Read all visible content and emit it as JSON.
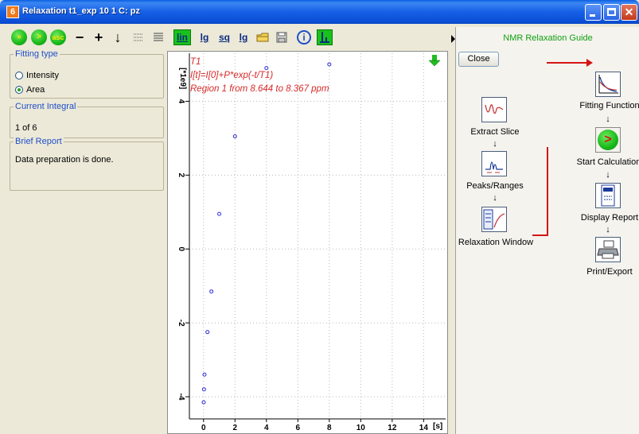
{
  "window": {
    "badge": "6",
    "title": "Relaxation t1_exp  10  1  C: pz"
  },
  "toolbar": {
    "btn_run_all": "»",
    "btn_run": ">",
    "btn_asc": "asc",
    "btn_minus": "−",
    "btn_plus": "+",
    "btn_down": "↓",
    "btn_lin": "lin",
    "btn_lg1": "lg",
    "btn_sq": "sq",
    "btn_lg2": "lg",
    "btn_info": "i"
  },
  "fitting_type": {
    "legend": "Fitting type",
    "options": [
      {
        "label": "Intensity",
        "selected": false
      },
      {
        "label": "Area",
        "selected": true
      }
    ]
  },
  "current_integral": {
    "legend": "Current Integral",
    "value": "1 of 6"
  },
  "brief_report": {
    "legend": "Brief Report",
    "text": "Data preparation is done."
  },
  "chart_data": {
    "type": "scatter",
    "annotation_lines": [
      "T1",
      "I[t]=I[0]+P*exp(-t/T1)",
      "Region 1 from 8.644 to 8.367 ppm"
    ],
    "ylabel": "[*1e9]",
    "xlabel_unit": "[s]",
    "x_ticks": [
      "0",
      "2",
      "4",
      "6",
      "8",
      "10",
      "12",
      "14"
    ],
    "y_ticks": [
      "-4",
      "-2",
      "0",
      "2",
      "4"
    ],
    "xlim": [
      -0.9,
      15.4
    ],
    "ylim": [
      -4.6,
      5.3
    ],
    "grid": true,
    "marker_color": "#2b2bd6",
    "points": [
      {
        "x": 0.01,
        "y": -4.15
      },
      {
        "x": 0.03,
        "y": -3.8
      },
      {
        "x": 0.06,
        "y": -3.4
      },
      {
        "x": 0.25,
        "y": -2.25
      },
      {
        "x": 0.5,
        "y": -1.15
      },
      {
        "x": 1.0,
        "y": 0.95
      },
      {
        "x": 2.0,
        "y": 3.05
      },
      {
        "x": 4.0,
        "y": 4.9
      },
      {
        "x": 8.0,
        "y": 5.0
      }
    ]
  },
  "guide": {
    "title": "NMR Relaxation Guide",
    "close_label": "Close",
    "arrow": "↓",
    "steps": {
      "extract_slice": "Extract Slice",
      "peaks_ranges": "Peaks/Ranges",
      "relaxation_window": "Relaxation Window",
      "fitting_function": "Fitting Function",
      "start_calculation": "Start Calculation",
      "display_report": "Display Report",
      "print_export": "Print/Export"
    }
  }
}
